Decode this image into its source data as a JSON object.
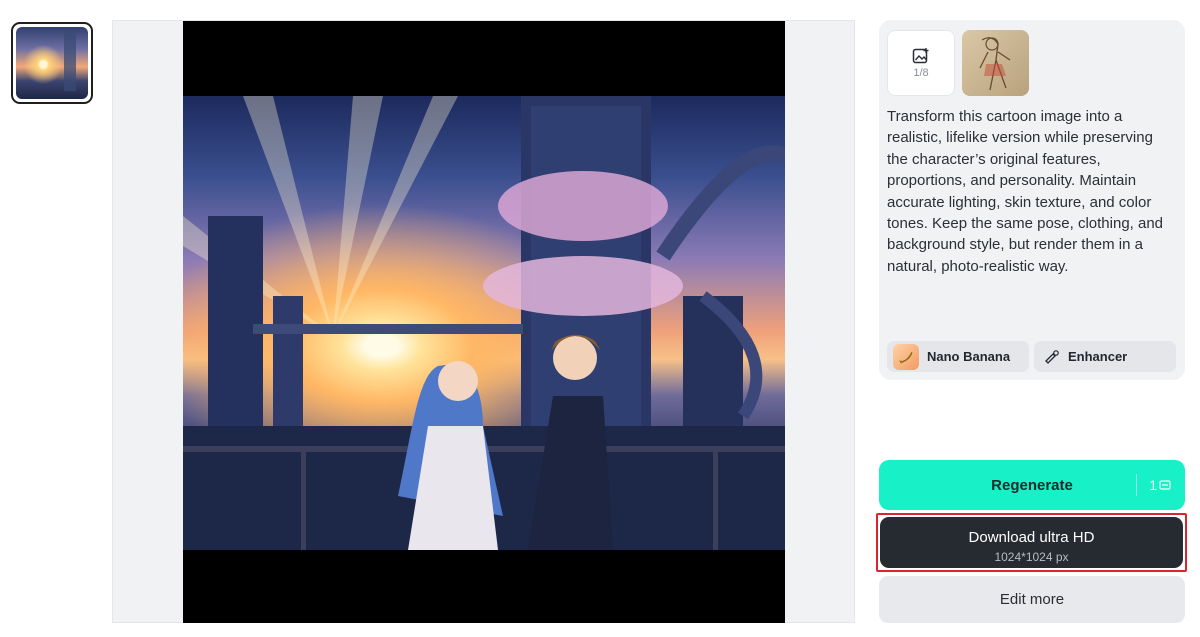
{
  "history": {
    "thumbnails": [
      {
        "icon": "anime-city-sunset-thumbnail",
        "selected": true
      }
    ]
  },
  "preview": {
    "image_icon": "anime-couple-city-sunset-image"
  },
  "sidebar": {
    "upload": {
      "icon": "add-image-icon",
      "count": "1/8"
    },
    "reference_icon": "sketch-reference-thumbnail",
    "prompt": "Transform this cartoon image into a realistic, lifelike version while preserving the character’s original features, proportions, and personality. Maintain accurate lighting, skin texture, and color tones. Keep the same pose, clothing, and background style, but render them in a natural, photo-realistic way.",
    "model_chip": {
      "label": "Nano Banana",
      "icon": "banana-model-icon"
    },
    "enhancer_chip": {
      "label": "Enhancer",
      "icon": "enhancer-icon"
    }
  },
  "actions": {
    "regenerate": {
      "label": "Regenerate",
      "credits": "1",
      "accent": "#18f0c8"
    },
    "download": {
      "label": "Download ultra HD",
      "resolution": "1024*1024 px",
      "highlight": "#d7262e"
    },
    "edit_more": {
      "label": "Edit more"
    }
  }
}
